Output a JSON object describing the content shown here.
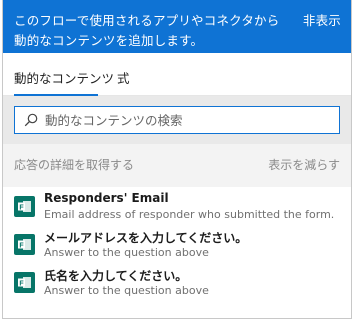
{
  "header": {
    "title": "このフローで使用されるアプリやコネクタから動的なコンテンツを追加します。",
    "hide_label": "非表示"
  },
  "tabs": [
    {
      "label": "動的なコンテンツ",
      "active": true
    },
    {
      "label": "式",
      "active": false
    }
  ],
  "search": {
    "placeholder": "動的なコンテンツの検索",
    "value": ""
  },
  "section": {
    "title": "応答の詳細を取得する",
    "toggle_label": "表示を減らす"
  },
  "items": [
    {
      "name": "Responders' Email",
      "description": "Email address of responder who submitted the form.",
      "icon": "forms-icon"
    },
    {
      "name": "メールアドレスを入力してください。",
      "description": "Answer to the question above",
      "icon": "forms-icon"
    },
    {
      "name": "氏名を入力してください。",
      "description": "Answer to the question above",
      "icon": "forms-icon"
    }
  ],
  "colors": {
    "accent": "#0f73d4",
    "forms_icon_bg": "#077568"
  }
}
